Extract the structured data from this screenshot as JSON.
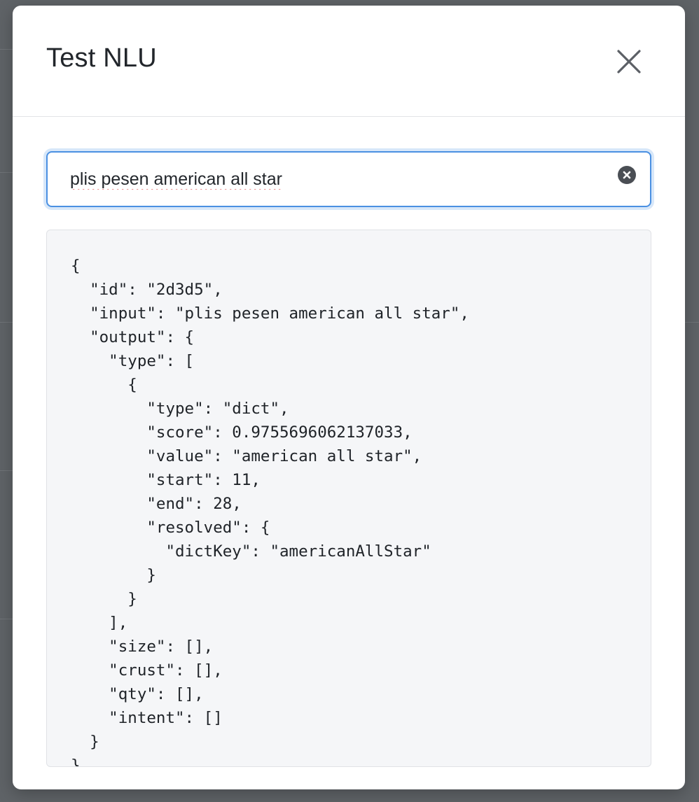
{
  "modal": {
    "title": "Test NLU",
    "close_icon": "close-icon"
  },
  "search": {
    "value": "plis pesen american all star",
    "clear_icon": "clear-circle-icon"
  },
  "result": {
    "json_text": "{\n  \"id\": \"2d3d5\",\n  \"input\": \"plis pesen american all star\",\n  \"output\": {\n    \"type\": [\n      {\n        \"type\": \"dict\",\n        \"score\": 0.9755696062137033,\n        \"value\": \"american all star\",\n        \"start\": 11,\n        \"end\": 28,\n        \"resolved\": {\n          \"dictKey\": \"americanAllStar\"\n        }\n      }\n    ],\n    \"size\": [],\n    \"crust\": [],\n    \"qty\": [],\n    \"intent\": []\n  }\n}"
  },
  "colors": {
    "accent": "#4a90e2",
    "overlay": "#5f6367",
    "code_background": "#f5f6f8"
  }
}
